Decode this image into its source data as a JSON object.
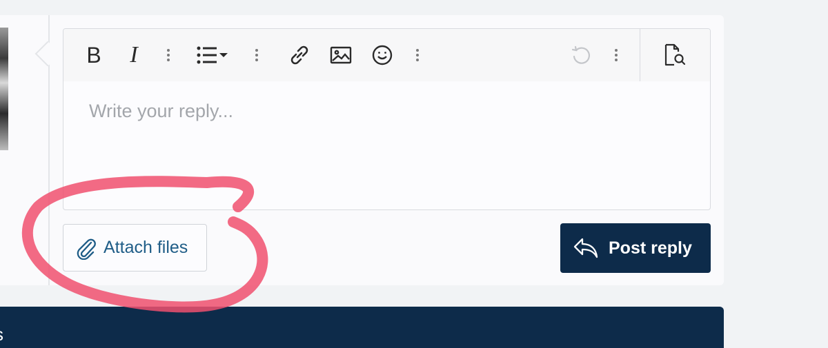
{
  "editor": {
    "toolbar": {
      "bold_label": "B",
      "italic_label": "I",
      "icons": [
        "bold-icon",
        "italic-icon",
        "more-options-icon",
        "list-icon",
        "link-icon",
        "image-icon",
        "smiley-icon",
        "undo-icon",
        "preview-icon"
      ]
    },
    "placeholder": "Write your reply..."
  },
  "actions": {
    "attach_label": "Attach files",
    "post_label": "Post reply"
  },
  "footer": {
    "fragment": "s"
  },
  "colors": {
    "primary": "#0d2b4a",
    "link": "#1f5d87",
    "annotation": "#f0506e"
  }
}
